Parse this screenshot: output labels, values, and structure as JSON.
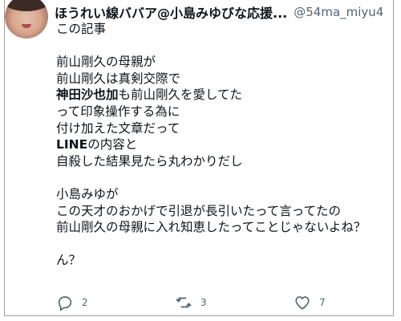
{
  "tweet": {
    "display_name": "ほうれい線ババア@小島みゆびな応援...",
    "handle": "@54ma_miyu4...",
    "lines": [
      [
        {
          "text": "この記事",
          "bold": false
        }
      ],
      [],
      [
        {
          "text": "前山剛久の母親が",
          "bold": false
        }
      ],
      [
        {
          "text": "前山剛久は真剣交際で",
          "bold": false
        }
      ],
      [
        {
          "text": "神田沙也加",
          "bold": true
        },
        {
          "text": "も前山剛久を愛してた",
          "bold": false
        }
      ],
      [
        {
          "text": "って印象操作する為に",
          "bold": false
        }
      ],
      [
        {
          "text": "付け加えた文章だって",
          "bold": false
        }
      ],
      [
        {
          "text": "LINE",
          "bold": true
        },
        {
          "text": "の内容と",
          "bold": false
        }
      ],
      [
        {
          "text": "自殺した結果見たら丸わかりだし",
          "bold": false
        }
      ],
      [],
      [
        {
          "text": "小島みゆが",
          "bold": false
        }
      ],
      [
        {
          "text": "この天才のおかげで引退が長引いたって言ってたの",
          "bold": false
        }
      ],
      [
        {
          "text": "前山剛久の母親に入れ知恵したってことじゃないよね？",
          "bold": false
        }
      ],
      [],
      [
        {
          "text": "ん？",
          "bold": false
        }
      ]
    ],
    "actions": {
      "reply_count": "2",
      "retweet_count": "3",
      "like_count": "7"
    },
    "icons": {
      "reply": "reply-icon",
      "retweet": "retweet-icon",
      "like": "heart-icon"
    },
    "colors": {
      "text": "#0f1419",
      "muted": "#536471",
      "border": "#9e9e9e"
    }
  }
}
